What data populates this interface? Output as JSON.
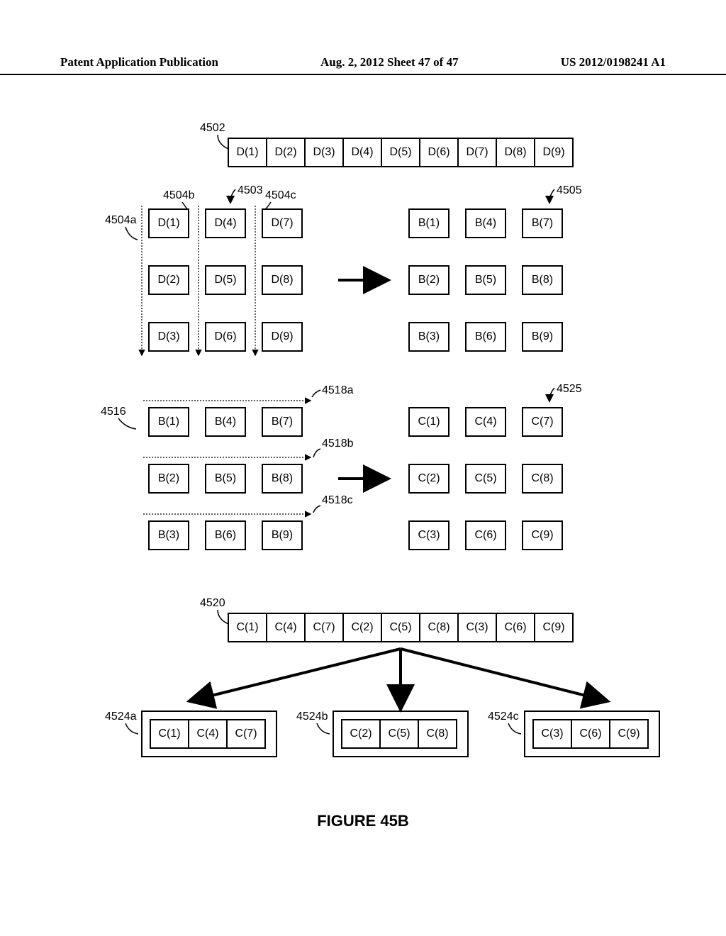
{
  "header": {
    "left": "Patent Application Publication",
    "center": "Aug. 2, 2012  Sheet 47 of 47",
    "right": "US 2012/0198241 A1"
  },
  "figure_caption": "FIGURE 45B",
  "labels": {
    "l4502": "4502",
    "l4503": "4503",
    "l4504a": "4504a",
    "l4504b": "4504b",
    "l4504c": "4504c",
    "l4505": "4505",
    "l4516": "4516",
    "l4518a": "4518a",
    "l4518b": "4518b",
    "l4518c": "4518c",
    "l4520": "4520",
    "l4524a": "4524a",
    "l4524b": "4524b",
    "l4524c": "4524c",
    "l4525": "4525"
  },
  "row4502": [
    "D(1)",
    "D(2)",
    "D(3)",
    "D(4)",
    "D(5)",
    "D(6)",
    "D(7)",
    "D(8)",
    "D(9)"
  ],
  "grid_d": [
    [
      "D(1)",
      "D(4)",
      "D(7)"
    ],
    [
      "D(2)",
      "D(5)",
      "D(8)"
    ],
    [
      "D(3)",
      "D(6)",
      "D(9)"
    ]
  ],
  "grid_b1": [
    [
      "B(1)",
      "B(4)",
      "B(7)"
    ],
    [
      "B(2)",
      "B(5)",
      "B(8)"
    ],
    [
      "B(3)",
      "B(6)",
      "B(9)"
    ]
  ],
  "grid_b2": [
    [
      "B(1)",
      "B(4)",
      "B(7)"
    ],
    [
      "B(2)",
      "B(5)",
      "B(8)"
    ],
    [
      "B(3)",
      "B(6)",
      "B(9)"
    ]
  ],
  "grid_c1": [
    [
      "C(1)",
      "C(4)",
      "C(7)"
    ],
    [
      "C(2)",
      "C(5)",
      "C(8)"
    ],
    [
      "C(3)",
      "C(6)",
      "C(9)"
    ]
  ],
  "row4520": [
    "C(1)",
    "C(4)",
    "C(7)",
    "C(2)",
    "C(5)",
    "C(8)",
    "C(3)",
    "C(6)",
    "C(9)"
  ],
  "tri_a": [
    "C(1)",
    "C(4)",
    "C(7)"
  ],
  "tri_b": [
    "C(2)",
    "C(5)",
    "C(8)"
  ],
  "tri_c": [
    "C(3)",
    "C(6)",
    "C(9)"
  ]
}
